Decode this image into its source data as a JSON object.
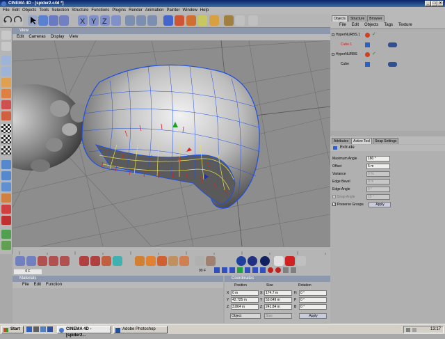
{
  "window": {
    "title": "CINEMA 4D - [spider2.c4d *]",
    "min": "_",
    "max": "□",
    "close": "×"
  },
  "menu": [
    "File",
    "Edit",
    "Objects",
    "Tools",
    "Selection",
    "Structure",
    "Functions",
    "Plugins",
    "Render",
    "Animation",
    "Painter",
    "Window",
    "Help"
  ],
  "viewport": {
    "title": "View",
    "menu": [
      "Edit",
      "Cameras",
      "Display",
      "View"
    ]
  },
  "timeline": {
    "frame": "0 F",
    "end": "90 F"
  },
  "materials": {
    "title": "Materials",
    "menu": [
      "File",
      "Edit",
      "Function"
    ]
  },
  "coordinates": {
    "title": "Coordinates",
    "headers": [
      "Position",
      "Size",
      "Rotation"
    ],
    "rows": [
      {
        "axis": "X",
        "pos": "0 m",
        "size_axis": "X",
        "size": "174.7 m",
        "rot_axis": "H",
        "rot": "0 °"
      },
      {
        "axis": "Y",
        "pos": "42.725 m",
        "size_axis": "Y",
        "size": "53.649 m",
        "rot_axis": "P",
        "rot": "0 °"
      },
      {
        "axis": "Z",
        "pos": "3.864 m",
        "size_axis": "Z",
        "size": "241.84 m",
        "rot_axis": "B",
        "rot": "0 °"
      }
    ],
    "mode": "Object",
    "size_mode": "Size",
    "apply": "Apply"
  },
  "objects_panel": {
    "tabs": [
      "Objects",
      "Structure",
      "Browser"
    ],
    "menu": [
      "File",
      "Edit",
      "Objects",
      "Tags",
      "Texture"
    ],
    "items": [
      {
        "name": "HyperNURBS.1",
        "indent": 0
      },
      {
        "name": "Cube.1",
        "indent": 1
      },
      {
        "name": "HyperNURBS",
        "indent": 0
      },
      {
        "name": "Cube",
        "indent": 1
      }
    ]
  },
  "attributes": {
    "tabs": [
      "Attributes",
      "Active Tool",
      "Snap Settings"
    ],
    "tool": "Extrude",
    "fields": [
      {
        "label": "Maximum Angle",
        "value": "180 °"
      },
      {
        "label": "Offset",
        "value": "5 m"
      },
      {
        "label": "Variance",
        "value": "0 %"
      },
      {
        "label": "Edge Bevel",
        "value": "0 m"
      },
      {
        "label": "Edge Angle",
        "value": "0 °"
      },
      {
        "label": "Snap Angle",
        "value": "15 °"
      }
    ],
    "preserve": "Preserve Groups",
    "apply": "Apply"
  },
  "taskbar": {
    "start": "Start",
    "tasks": [
      "CINEMA 4D - [spider2...",
      "Adobe Photoshop"
    ],
    "clock": "13:17"
  }
}
